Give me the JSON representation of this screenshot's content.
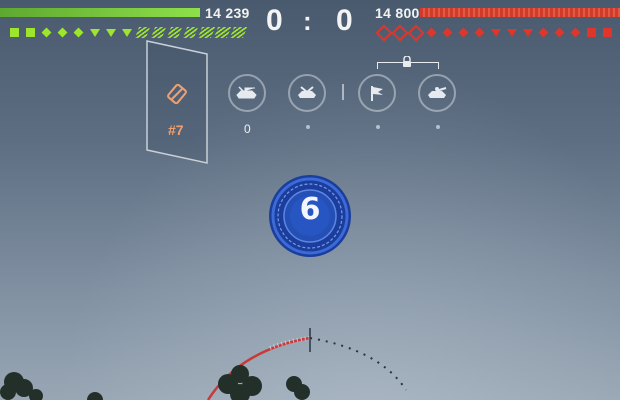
{
  "hud": {
    "ally_hp": "14 239",
    "enemy_hp": "14 800",
    "score_ally": "0",
    "score_separator": ":",
    "score_enemy": "0",
    "ally_color": "#9ee52e",
    "enemy_color": "#e0352b",
    "ally_vehicle_icons": [
      "square",
      "square",
      "diamond",
      "diamond",
      "diamond",
      "triangle",
      "triangle",
      "triangle",
      "hatched",
      "hatched",
      "hatched",
      "hatched",
      "hatched-double",
      "hatched-double",
      "hatched-double"
    ],
    "enemy_vehicle_icons": [
      "ring",
      "ring",
      "ring",
      "diamond",
      "diamond",
      "diamond",
      "diamond",
      "triangle",
      "triangle",
      "triangle",
      "diamond",
      "diamond",
      "diamond",
      "square",
      "square"
    ]
  },
  "player_panel": {
    "rank": "#7",
    "icon": "reload-card-icon"
  },
  "objectives": [
    {
      "name": "damage-tank-icon",
      "value": "0"
    },
    {
      "name": "destroy-tank-icon",
      "value": ""
    },
    {
      "name": "capture-flag-icon",
      "value": ""
    },
    {
      "name": "spot-tank-icon",
      "value": ""
    }
  ],
  "timer": {
    "value": "6",
    "accent": "#2d58c8"
  }
}
